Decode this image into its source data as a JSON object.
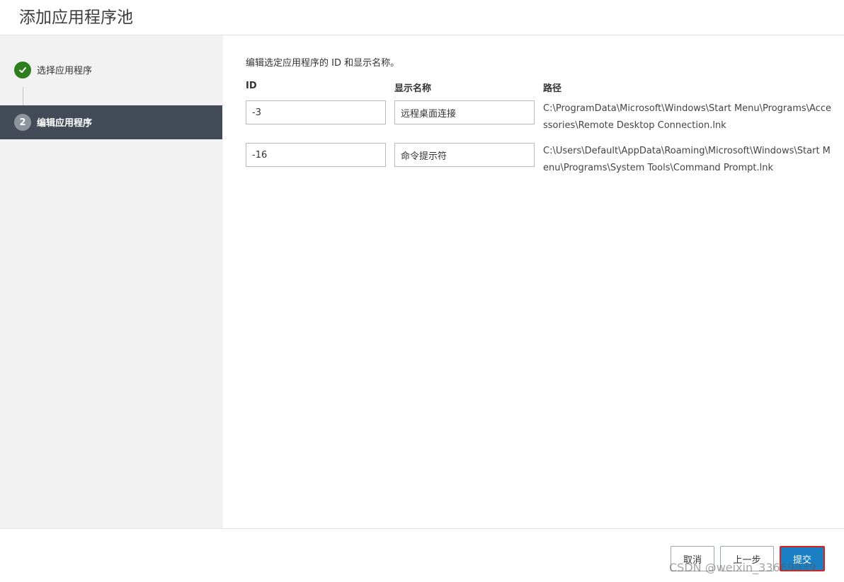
{
  "header": {
    "title": "添加应用程序池"
  },
  "wizard": {
    "steps": [
      {
        "number": "✓",
        "label": "选择应用程序",
        "state": "completed"
      },
      {
        "number": "2",
        "label": "编辑应用程序",
        "state": "active"
      }
    ]
  },
  "main": {
    "instructions": "编辑选定应用程序的 ID 和显示名称。",
    "columns": {
      "id": "ID",
      "name": "显示名称",
      "path": "路径"
    },
    "rows": [
      {
        "id": "-3",
        "name": "远程桌面连接",
        "path": "C:\\ProgramData\\Microsoft\\Windows\\Start Menu\\Programs\\Accessories\\Remote Desktop Connection.lnk"
      },
      {
        "id": "-16",
        "name": "命令提示符",
        "path": "C:\\Users\\Default\\AppData\\Roaming\\Microsoft\\Windows\\Start Menu\\Programs\\System Tools\\Command Prompt.lnk"
      }
    ]
  },
  "footer": {
    "cancel_label": "取消",
    "back_label": "上一步",
    "submit_label": "提交",
    "watermark": "CSDN @weixin_33669839"
  },
  "colors": {
    "active_step_bg": "#424b57",
    "completed_step": "#2e7d1e",
    "primary_button": "#1b7fc4",
    "highlight_border": "#e0201e"
  }
}
